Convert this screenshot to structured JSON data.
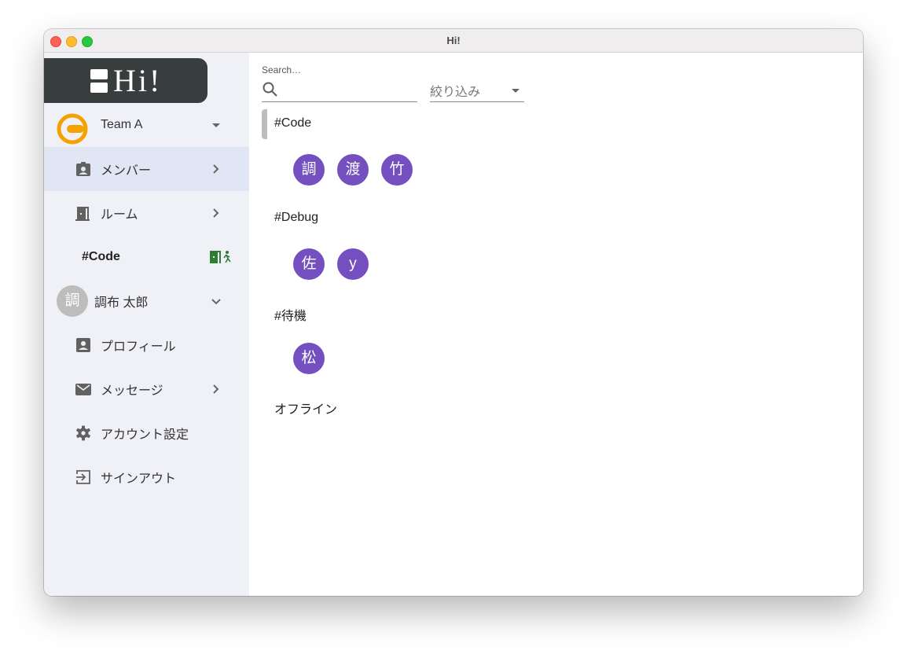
{
  "window": {
    "title": "Hi!"
  },
  "sidebar": {
    "logo_text": "Hi!",
    "team": {
      "name": "Team A",
      "brand_color": "#f5a200"
    },
    "nav": [
      {
        "label": "メンバー",
        "icon": "badge-icon",
        "active": true,
        "has_chevron": true
      },
      {
        "label": "ルーム",
        "icon": "door-icon",
        "active": false,
        "has_chevron": true
      }
    ],
    "current_room": {
      "label": "#Code",
      "action_icon": "exit-room-icon",
      "action_color": "#2e7d32"
    },
    "user": {
      "avatar_text": "調",
      "name": "調布 太郎"
    },
    "user_menu": [
      {
        "label": "プロフィール",
        "icon": "account-box-icon",
        "has_chevron": false
      },
      {
        "label": "メッセージ",
        "icon": "mail-icon",
        "has_chevron": true
      },
      {
        "label": "アカウント設定",
        "icon": "gear-icon",
        "has_chevron": false
      },
      {
        "label": "サインアウト",
        "icon": "sign-out-icon",
        "has_chevron": false
      }
    ]
  },
  "main": {
    "search": {
      "label": "Search…",
      "value": "",
      "placeholder": ""
    },
    "filter": {
      "label": "絞り込み"
    },
    "groups": [
      {
        "name": "#Code",
        "members": [
          "調",
          "渡",
          "竹"
        ]
      },
      {
        "name": "#Debug",
        "members": [
          "佐",
          "y"
        ]
      },
      {
        "name": "#待機",
        "members": [
          "松"
        ]
      },
      {
        "name": "オフライン",
        "members": []
      }
    ],
    "avatar_color": "#744fbf"
  }
}
